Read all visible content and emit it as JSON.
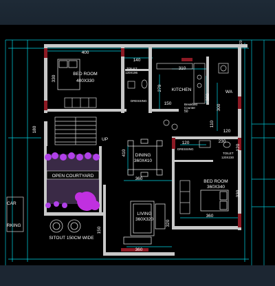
{
  "rooms": {
    "bedroom1": {
      "name": "BED ROOM",
      "size": "400X330"
    },
    "toilet1": {
      "name": "TOILET",
      "size": "120X196"
    },
    "dressing1": {
      "name": "DRESSING"
    },
    "kitchen": {
      "name": "KITCHEN"
    },
    "wa": {
      "name": "WA"
    },
    "breakfast": {
      "name": "Breakfast",
      "sub": "Counter"
    },
    "dining": {
      "name": "DINING",
      "size": "360X410"
    },
    "dressing2": {
      "name": "DRESSING"
    },
    "toilet2": {
      "name": "TOILET",
      "size": "120X230"
    },
    "bedroom2": {
      "name": "BED ROOM",
      "size": "360X340"
    },
    "courtyard": {
      "name": "OPEN COURTYARD"
    },
    "living": {
      "name": "LIVING",
      "size": "360X320"
    },
    "sitout": {
      "name": "SITOUT 150CM WIDE"
    },
    "car": {
      "line1": "CAR",
      "line2": "RKING"
    },
    "up": {
      "label": "UP"
    }
  },
  "dims": {
    "d400": "400",
    "d140": "140",
    "d330a": "330",
    "d310": "310",
    "d279": "279",
    "d150": "150",
    "d50": "50",
    "d380": "380",
    "d300": "300",
    "d110": "110",
    "d180": "180",
    "d410": "410",
    "d360a": "360",
    "d120a": "120",
    "d230": "230",
    "d120b": "120",
    "d120c": "120",
    "d330b": "330",
    "d360b": "360",
    "d320": "320",
    "d150b": "150",
    "d360c": "360",
    "d20": "20"
  },
  "colors": {
    "wall": "#c8c8c8",
    "dimension": "#00d8e8",
    "text": "#ffffff",
    "column": "#8c1a24",
    "planter": "#b040e8",
    "courtyard": "#3a2a46"
  }
}
